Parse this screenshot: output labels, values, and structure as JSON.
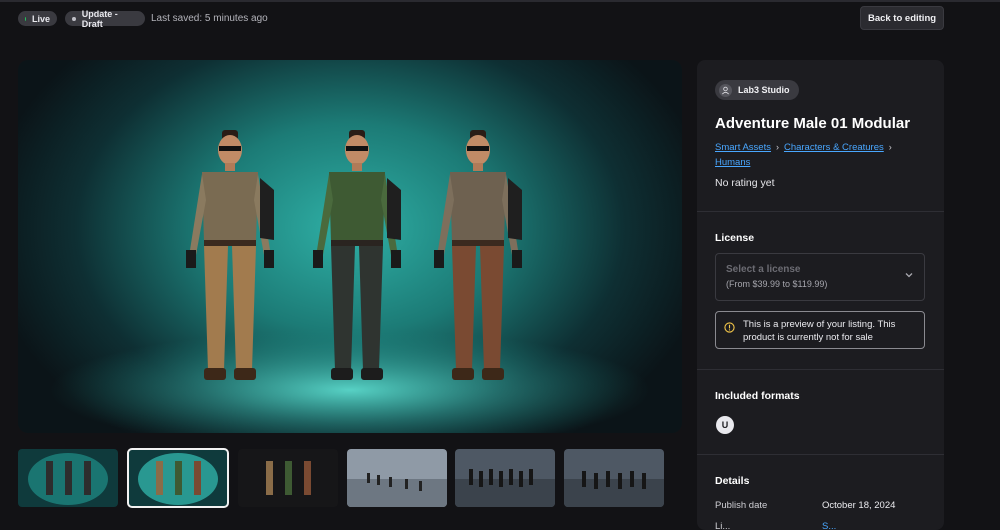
{
  "topbar": {
    "status_live": "Live",
    "status_draft": "Update - Draft",
    "last_saved": "Last saved: 5 minutes ago",
    "back_button": "Back to editing",
    "live_dot_color": "#22c55e",
    "draft_dot_color": "#bfbfc6"
  },
  "gallery": {
    "selected_index": 1,
    "thumbnail_count": 6
  },
  "product": {
    "studio": "Lab3 Studio",
    "title": "Adventure Male 01 Modular",
    "breadcrumbs": [
      "Smart Assets",
      "Characters & Creatures",
      "Humans"
    ],
    "rating": "No rating yet"
  },
  "license": {
    "heading": "License",
    "select_placeholder": "Select a license",
    "price_range": "(From $39.99 to $119.99)",
    "notice": "This is a preview of your listing. This product is currently not for sale"
  },
  "formats": {
    "heading": "Included formats",
    "items": [
      {
        "icon": "unreal-engine-icon",
        "label": "U"
      }
    ]
  },
  "details": {
    "heading": "Details",
    "rows": [
      {
        "label": "Publish date",
        "value": "October 18, 2024"
      },
      {
        "label": "Li...",
        "value": "S..."
      }
    ]
  },
  "colors": {
    "link": "#49a7ff",
    "teal": "#2fb0a6",
    "panel": "#1c1c20"
  }
}
